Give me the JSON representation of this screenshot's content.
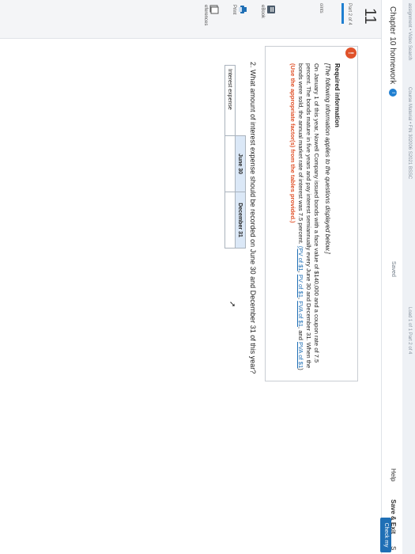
{
  "topbar": {
    "crumb": "assignment • Video Search",
    "course": "Course Material • FIN 302006 S2021 BSSC",
    "loader": "Load 1 of 1 Part 2 of 4"
  },
  "header": {
    "chapter_title": "Chapter 10 homework",
    "info_glyph": "i",
    "saved": "Saved",
    "help": "Help",
    "save_exit": "Save & Exit",
    "submit": "S",
    "check_my_work": "Check my"
  },
  "question_nav": {
    "number": "11",
    "part": "Part 2 of 4",
    "points": "oints"
  },
  "tools": {
    "ebook": "eBook",
    "print": "Print",
    "references": "eferences"
  },
  "required_info": {
    "icon": "!",
    "title": "Required information",
    "intro": "[The following information applies to the questions displayed below.]",
    "body_part1": "On January 1 of this year, Nowell Company issued bonds with a face value of $140,000 and a coupon rate of 7.5 percent. The bonds mature in five years and pay interest semiannually every June 30 and December 31. When the bonds were sold, the annual market rate of interest was 7.5 percent. ",
    "link_pv": "(PV of $1",
    "sep1": ", ",
    "link_pva": "PV of $1",
    "sep2": ", ",
    "link_fva": "FVA of $1",
    "sep3": ", and ",
    "link_pvaa": "PVA of $1",
    "sep4": ") ",
    "instruction": "(Use the appropriate factor(s) from the tables provided.)"
  },
  "question": {
    "text": "2. What amount of interest expense should be recorded on June 30 and December 31 of this year?"
  },
  "table": {
    "col_june": "June 30",
    "col_dec": "December 31",
    "row_label": "Interest expense",
    "june_value": "",
    "dec_value": ""
  },
  "cursor_glyph": "➚"
}
